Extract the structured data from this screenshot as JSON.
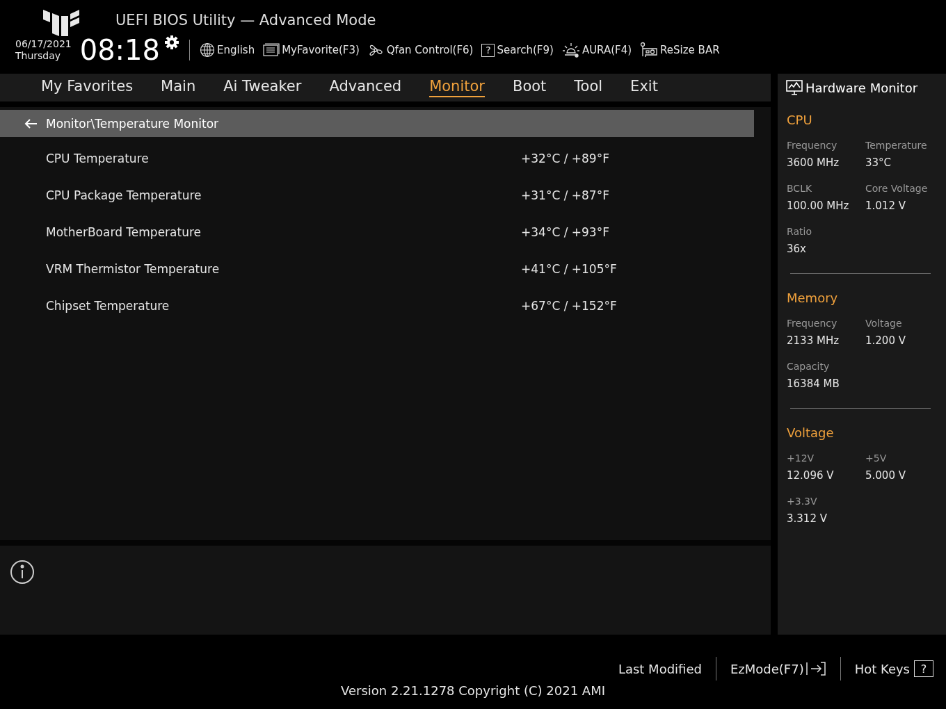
{
  "header": {
    "title": "UEFI BIOS Utility — Advanced Mode",
    "date": "06/17/2021",
    "day": "Thursday",
    "time": "08:18",
    "tools": [
      {
        "kind": "globe",
        "label": "English"
      },
      {
        "kind": "favorite",
        "label": "MyFavorite(F3)"
      },
      {
        "kind": "fan",
        "label": "Qfan Control(F6)"
      },
      {
        "kind": "search",
        "icon": "?",
        "label": "Search(F9)"
      },
      {
        "kind": "aura",
        "label": "AURA(F4)"
      },
      {
        "kind": "resize",
        "label": "ReSize BAR"
      }
    ]
  },
  "tabs": [
    {
      "label": "My Favorites",
      "selected": false
    },
    {
      "label": "Main",
      "selected": false
    },
    {
      "label": "Ai Tweaker",
      "selected": false
    },
    {
      "label": "Advanced",
      "selected": false
    },
    {
      "label": "Monitor",
      "selected": true
    },
    {
      "label": "Boot",
      "selected": false
    },
    {
      "label": "Tool",
      "selected": false
    },
    {
      "label": "Exit",
      "selected": false
    }
  ],
  "breadcrumb": "Monitor\\Temperature Monitor",
  "rows": [
    {
      "label": "CPU Temperature",
      "value": "+32°C / +89°F"
    },
    {
      "label": "CPU Package Temperature",
      "value": "+31°C / +87°F"
    },
    {
      "label": "MotherBoard Temperature",
      "value": "+34°C / +93°F"
    },
    {
      "label": "VRM Thermistor Temperature",
      "value": "+41°C / +105°F"
    },
    {
      "label": "Chipset Temperature",
      "value": "+67°C / +152°F"
    }
  ],
  "hardware_monitor": {
    "title": "Hardware Monitor",
    "sections": [
      {
        "title": "CPU",
        "items": [
          {
            "label": "Frequency",
            "value": "3600 MHz"
          },
          {
            "label": "Temperature",
            "value": "33°C"
          },
          {
            "label": "BCLK",
            "value": "100.00 MHz"
          },
          {
            "label": "Core Voltage",
            "value": "1.012 V"
          },
          {
            "label": "Ratio",
            "value": "36x"
          }
        ]
      },
      {
        "title": "Memory",
        "items": [
          {
            "label": "Frequency",
            "value": "2133 MHz"
          },
          {
            "label": "Voltage",
            "value": "1.200 V"
          },
          {
            "label": "Capacity",
            "value": "16384 MB"
          }
        ]
      },
      {
        "title": "Voltage",
        "items": [
          {
            "label": "+12V",
            "value": "12.096 V"
          },
          {
            "label": "+5V",
            "value": "5.000 V"
          },
          {
            "label": "+3.3V",
            "value": "3.312 V"
          }
        ]
      }
    ]
  },
  "footer": {
    "buttons": [
      {
        "kind": "text",
        "label": "Last Modified"
      },
      {
        "kind": "exit",
        "label": "EzMode(F7)"
      },
      {
        "kind": "help",
        "label": "Hot Keys",
        "icon": "?"
      }
    ],
    "version": "Version 2.21.1278 Copyright (C) 2021 AMI"
  }
}
